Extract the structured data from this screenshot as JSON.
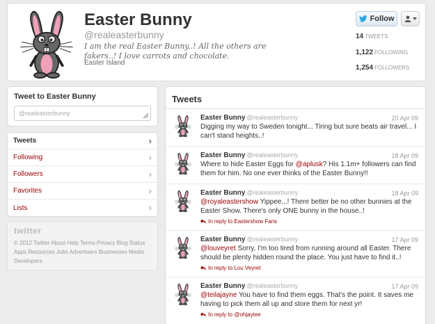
{
  "profile": {
    "name": "Easter Bunny",
    "handle": "@realeasterbunny",
    "bio": "I am the real Easter Bunny..! All the others are fakers..! I love carrots and chocolate.",
    "location": "Easter Island",
    "follow_label": "Follow",
    "stats": [
      {
        "count": "14",
        "label": "TWEETS"
      },
      {
        "count": "1,122",
        "label": "FOLLOWING"
      },
      {
        "count": "1,254",
        "label": "FOLLOWERS"
      }
    ]
  },
  "compose": {
    "title": "Tweet to Easter Bunny",
    "value": "@realeasterbunny"
  },
  "nav": {
    "items": [
      {
        "label": "Tweets",
        "active": true
      },
      {
        "label": "Following"
      },
      {
        "label": "Followers"
      },
      {
        "label": "Favorites"
      },
      {
        "label": "Lists"
      }
    ]
  },
  "footer": {
    "logo": "twitter",
    "links": "© 2012 Twitter  About  Help  Terms  Privacy  Blog  Status  Apps  Resources  Jobs  Advertisers  Businesses  Media  Developers"
  },
  "timeline": {
    "title": "Tweets",
    "tweets": [
      {
        "name": "Easter Bunny",
        "handle": "@realeasterbunny",
        "date": "20 Apr 09",
        "mention": "",
        "text": "Digging my way to Sweden tonight... Tiring but sure beats air travel... I can't stand heights..!",
        "reply": ""
      },
      {
        "name": "Easter Bunny",
        "handle": "@realeasterbunny",
        "date": "18 Apr 09",
        "text_before": "Where to hide Easter Eggs for ",
        "mention": "@aplusk",
        "text": "? His 1.1m+ followers can find them for him. No one ever thinks of the Easter Bunny!!",
        "reply": ""
      },
      {
        "name": "Easter Bunny",
        "handle": "@realeasterbunny",
        "date": "18 Apr 09",
        "mention": "@royaleastershow",
        "text": " Yippee...! There better be no other bunnies at the Easter Show. There's only ONE bunny in the house..!",
        "reply": "In reply to Eastershow Fans"
      },
      {
        "name": "Easter Bunny",
        "handle": "@realeasterbunny",
        "date": "17 Apr 09",
        "mention": "@louveyret",
        "text": " Sorry, I'm too tired from running around all Easter. There should be plenty hidden round the place. You just have to find it..!",
        "reply": "In reply to Lou Veyret"
      },
      {
        "name": "Easter Bunny",
        "handle": "@realeasterbunny",
        "date": "17 Apr 09",
        "mention": "@teilajayne",
        "text": " You have to find them eggs. That's the point. It saves me having to pick them all up and store them for next yr!",
        "reply": "In reply to @ohjaytee"
      }
    ]
  }
}
